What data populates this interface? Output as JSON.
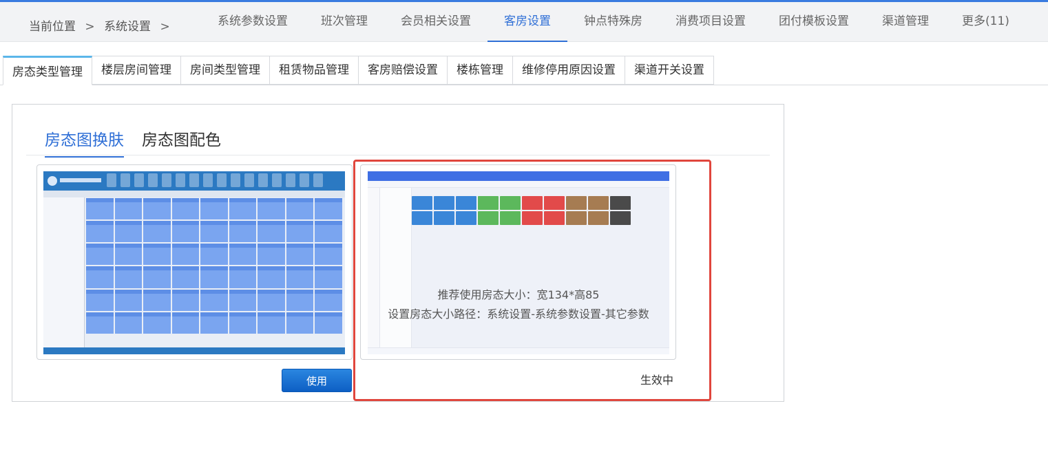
{
  "header": {
    "breadcrumb": {
      "label": "当前位置",
      "section": "系统设置"
    },
    "tabs": [
      "系统参数设置",
      "班次管理",
      "会员相关设置",
      "客房设置",
      "钟点特殊房",
      "消费项目设置",
      "团付模板设置",
      "渠道管理",
      "更多(11)"
    ],
    "active_tab": "客房设置"
  },
  "subtabs": [
    "房态类型管理",
    "楼层房间管理",
    "房间类型管理",
    "租赁物品管理",
    "客房赔偿设置",
    "楼栋管理",
    "维修停用原因设置",
    "渠道开关设置"
  ],
  "active_subtab": "房态类型管理",
  "content": {
    "inner_tabs": [
      "房态图换肤",
      "房态图配色"
    ],
    "active_inner_tab": "房态图换肤",
    "skins": [
      {
        "button_label": "使用"
      },
      {
        "note_line1": "推荐使用房态大小：宽134*高85",
        "note_line2": "设置房态大小路径：系统设置-系统参数设置-其它参数",
        "status": "生效中"
      }
    ]
  },
  "colors": {
    "accent": "#2f6fd6",
    "active_border": "#e0463d",
    "button": "#1271d4"
  }
}
